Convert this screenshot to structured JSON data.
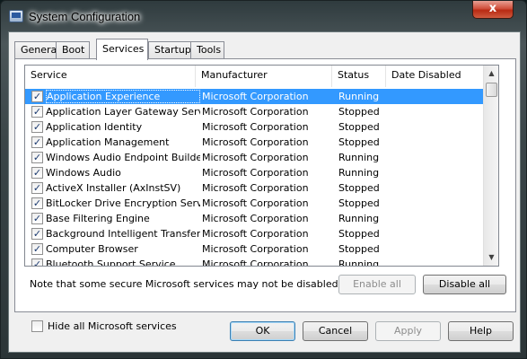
{
  "window": {
    "title": "System Configuration",
    "close_symbol": "x"
  },
  "tabs": [
    {
      "label": "General"
    },
    {
      "label": "Boot"
    },
    {
      "label": "Services"
    },
    {
      "label": "Startup"
    },
    {
      "label": "Tools"
    }
  ],
  "active_tab": "Services",
  "services_table": {
    "columns": [
      "Service",
      "Manufacturer",
      "Status",
      "Date Disabled"
    ],
    "rows": [
      {
        "checked": true,
        "service": "Application Experience",
        "manufacturer": "Microsoft Corporation",
        "status": "Running",
        "date_disabled": ""
      },
      {
        "checked": true,
        "service": "Application Layer Gateway Service",
        "manufacturer": "Microsoft Corporation",
        "status": "Stopped",
        "date_disabled": ""
      },
      {
        "checked": true,
        "service": "Application Identity",
        "manufacturer": "Microsoft Corporation",
        "status": "Stopped",
        "date_disabled": ""
      },
      {
        "checked": true,
        "service": "Application Management",
        "manufacturer": "Microsoft Corporation",
        "status": "Stopped",
        "date_disabled": ""
      },
      {
        "checked": true,
        "service": "Windows Audio Endpoint Builder",
        "manufacturer": "Microsoft Corporation",
        "status": "Running",
        "date_disabled": ""
      },
      {
        "checked": true,
        "service": "Windows Audio",
        "manufacturer": "Microsoft Corporation",
        "status": "Running",
        "date_disabled": ""
      },
      {
        "checked": true,
        "service": "ActiveX Installer (AxInstSV)",
        "manufacturer": "Microsoft Corporation",
        "status": "Stopped",
        "date_disabled": ""
      },
      {
        "checked": true,
        "service": "BitLocker Drive Encryption Service",
        "manufacturer": "Microsoft Corporation",
        "status": "Stopped",
        "date_disabled": ""
      },
      {
        "checked": true,
        "service": "Base Filtering Engine",
        "manufacturer": "Microsoft Corporation",
        "status": "Running",
        "date_disabled": ""
      },
      {
        "checked": true,
        "service": "Background Intelligent Transfer ...",
        "manufacturer": "Microsoft Corporation",
        "status": "Stopped",
        "date_disabled": ""
      },
      {
        "checked": true,
        "service": "Computer Browser",
        "manufacturer": "Microsoft Corporation",
        "status": "Stopped",
        "date_disabled": ""
      },
      {
        "checked": true,
        "service": "Bluetooth Support Service",
        "manufacturer": "Microsoft Corporation",
        "status": "Running",
        "date_disabled": ""
      }
    ],
    "selected_row": 0
  },
  "note": "Note that some secure Microsoft services may not be disabled.",
  "enable_all_label": "Enable all",
  "disable_all_label": "Disable all",
  "hide_ms_label": "Hide all Microsoft services",
  "hide_ms_checked": false,
  "check_mark": "✓",
  "scroll_up_glyph": "▲",
  "scroll_down_glyph": "▼",
  "footer": {
    "ok_label": "OK",
    "cancel_label": "Cancel",
    "apply_label": "Apply",
    "help_label": "Help"
  },
  "colors": {
    "selection": "#3399ff",
    "close_button": "#c8412a"
  }
}
